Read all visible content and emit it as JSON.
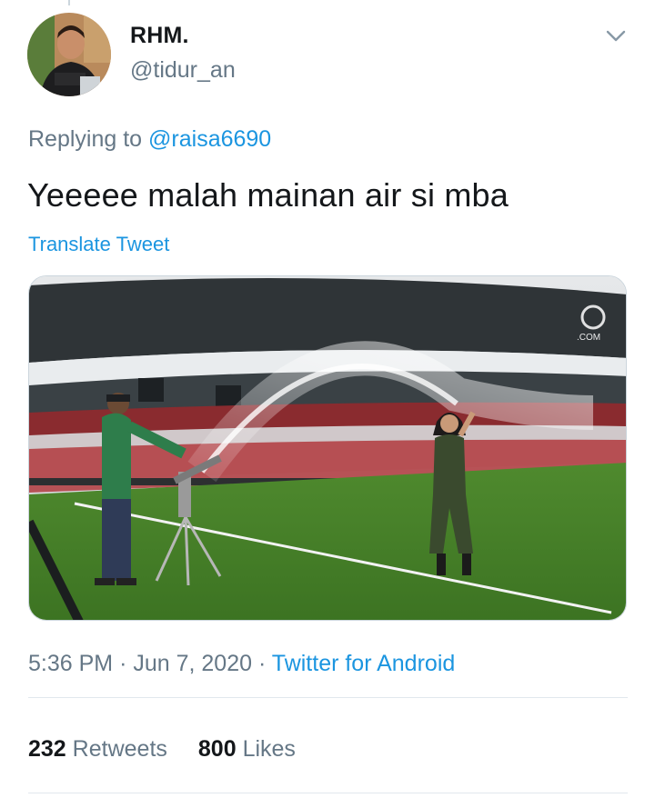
{
  "user": {
    "display_name": "RHM.",
    "handle": "@tidur_an"
  },
  "reply": {
    "prefix": "Replying to ",
    "to_handle": "@raisa6690"
  },
  "tweet": {
    "text": "Yeeeee malah mainan air si mba",
    "translate_label": "Translate Tweet",
    "media_watermark": ".COM"
  },
  "meta": {
    "time": "5:36 PM",
    "separator": "·",
    "date": "Jun 7, 2020",
    "source": "Twitter for Android"
  },
  "stats": {
    "retweets_count": "232",
    "retweets_label": "Retweets",
    "likes_count": "800",
    "likes_label": "Likes"
  },
  "icons": {
    "caret": "chevron-down-icon"
  },
  "colors": {
    "link": "#1b95e0",
    "secondary_text": "#657786",
    "primary_text": "#14171a",
    "divider": "#e1e8ed"
  }
}
